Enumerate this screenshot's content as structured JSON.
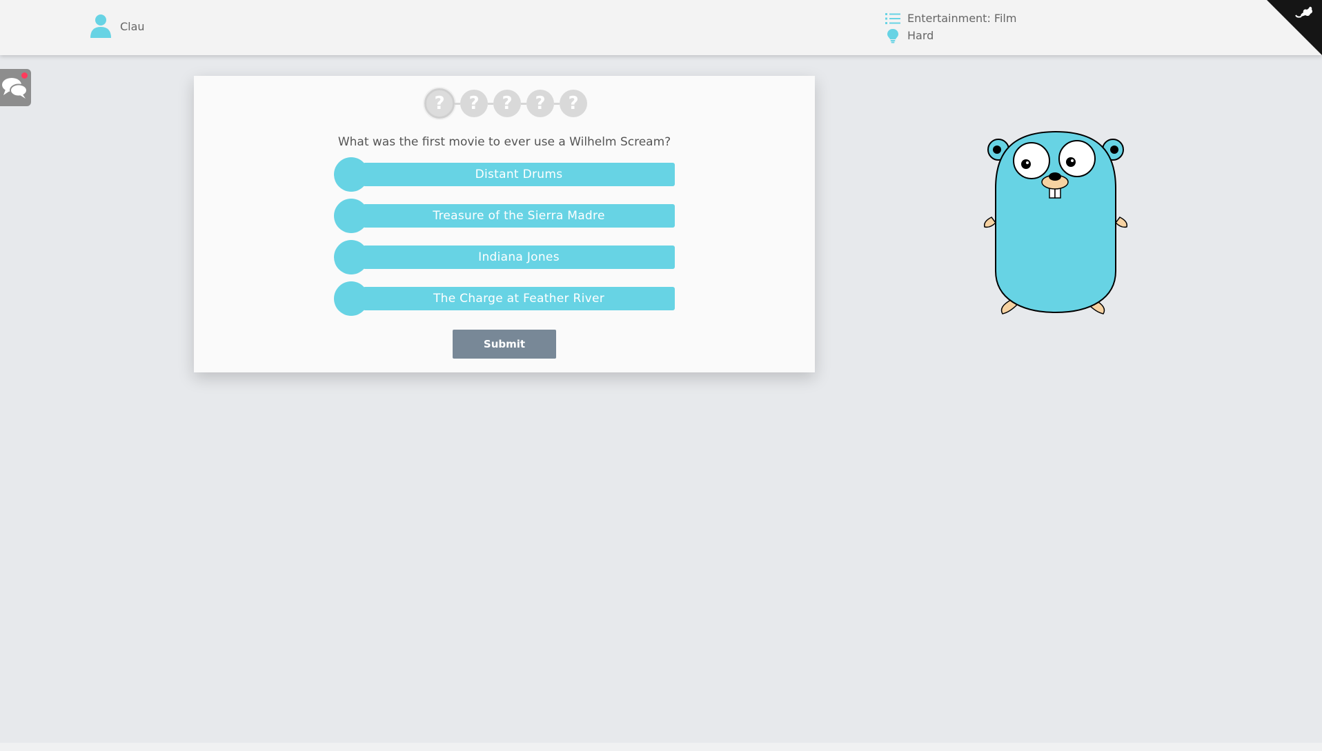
{
  "header": {
    "username": "Clau",
    "category": "Entertainment: Film",
    "difficulty": "Hard"
  },
  "progress": {
    "steps": [
      "?",
      "?",
      "?",
      "?",
      "?"
    ],
    "current_index": 0
  },
  "quiz": {
    "question": "What was the first movie to ever use a Wilhelm Scream?",
    "options": [
      "Distant Drums",
      "Treasure of the Sierra Madre",
      "Indiana Jones",
      "The Charge at Feather River"
    ],
    "submit_label": "Submit"
  },
  "colors": {
    "accent": "#67d3e4",
    "submit": "#788897",
    "page_bg": "#e7e9ec",
    "notification": "#ff3b5c"
  },
  "icons": {
    "user": "user-icon",
    "category": "list-icon",
    "difficulty": "lightbulb-icon",
    "chat": "chat-icon",
    "corner": "github-corner-icon",
    "mascot": "gopher-mascot"
  }
}
